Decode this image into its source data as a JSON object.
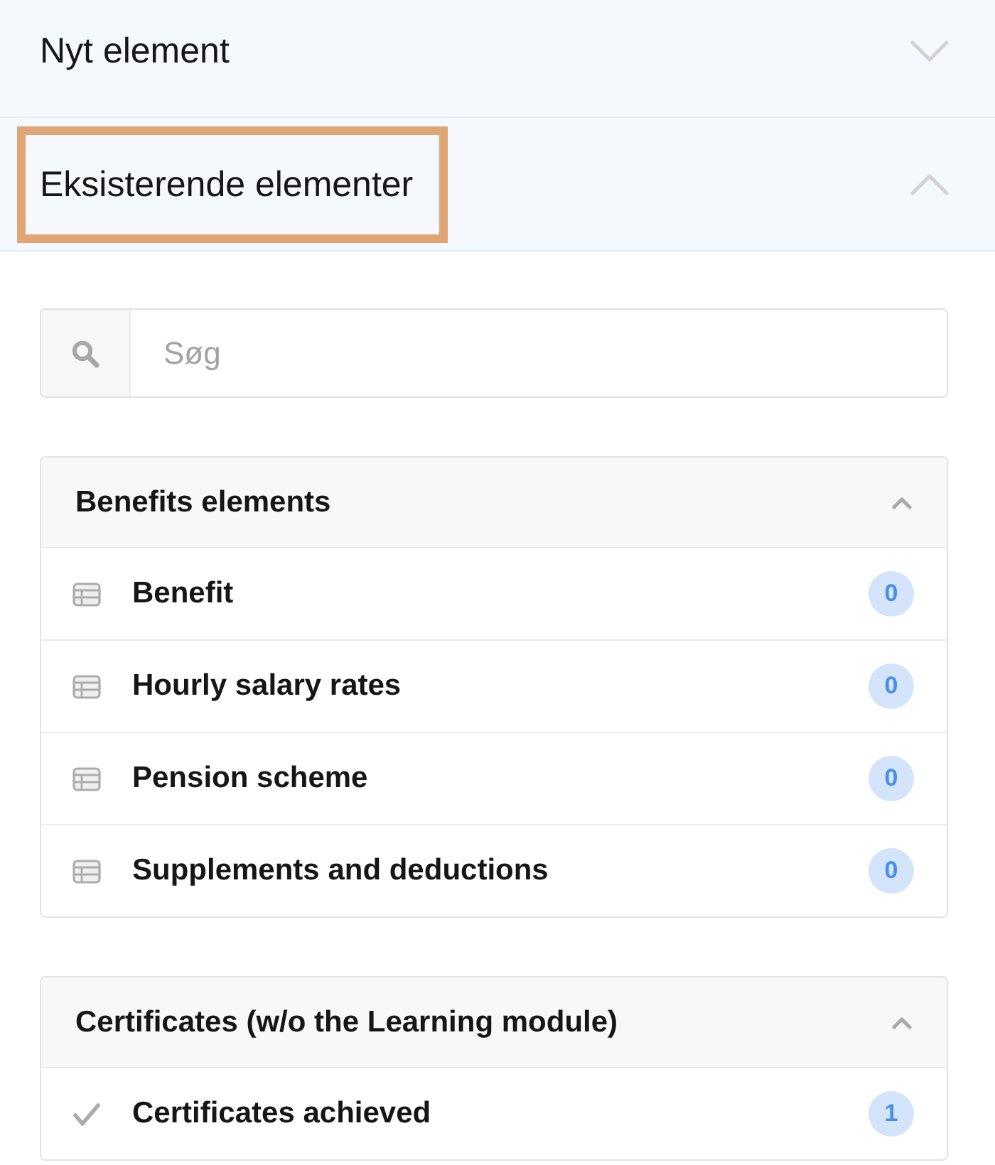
{
  "sections": [
    {
      "title": "Nyt element",
      "expanded": false,
      "highlighted": false
    },
    {
      "title": "Eksisterende elementer",
      "expanded": true,
      "highlighted": true,
      "search": {
        "placeholder": "Søg"
      },
      "groups": [
        {
          "title": "Benefits elements",
          "expanded": true,
          "items": [
            {
              "kind": "table",
              "label": "Benefit",
              "count": "0"
            },
            {
              "kind": "table",
              "label": "Hourly salary rates",
              "count": "0"
            },
            {
              "kind": "table",
              "label": "Pension scheme",
              "count": "0"
            },
            {
              "kind": "table",
              "label": "Supplements and deductions",
              "count": "0"
            }
          ]
        },
        {
          "title": "Certificates (w/o the Learning module)",
          "expanded": true,
          "items": [
            {
              "kind": "check",
              "label": "Certificates achieved",
              "count": "1"
            }
          ]
        }
      ]
    }
  ]
}
